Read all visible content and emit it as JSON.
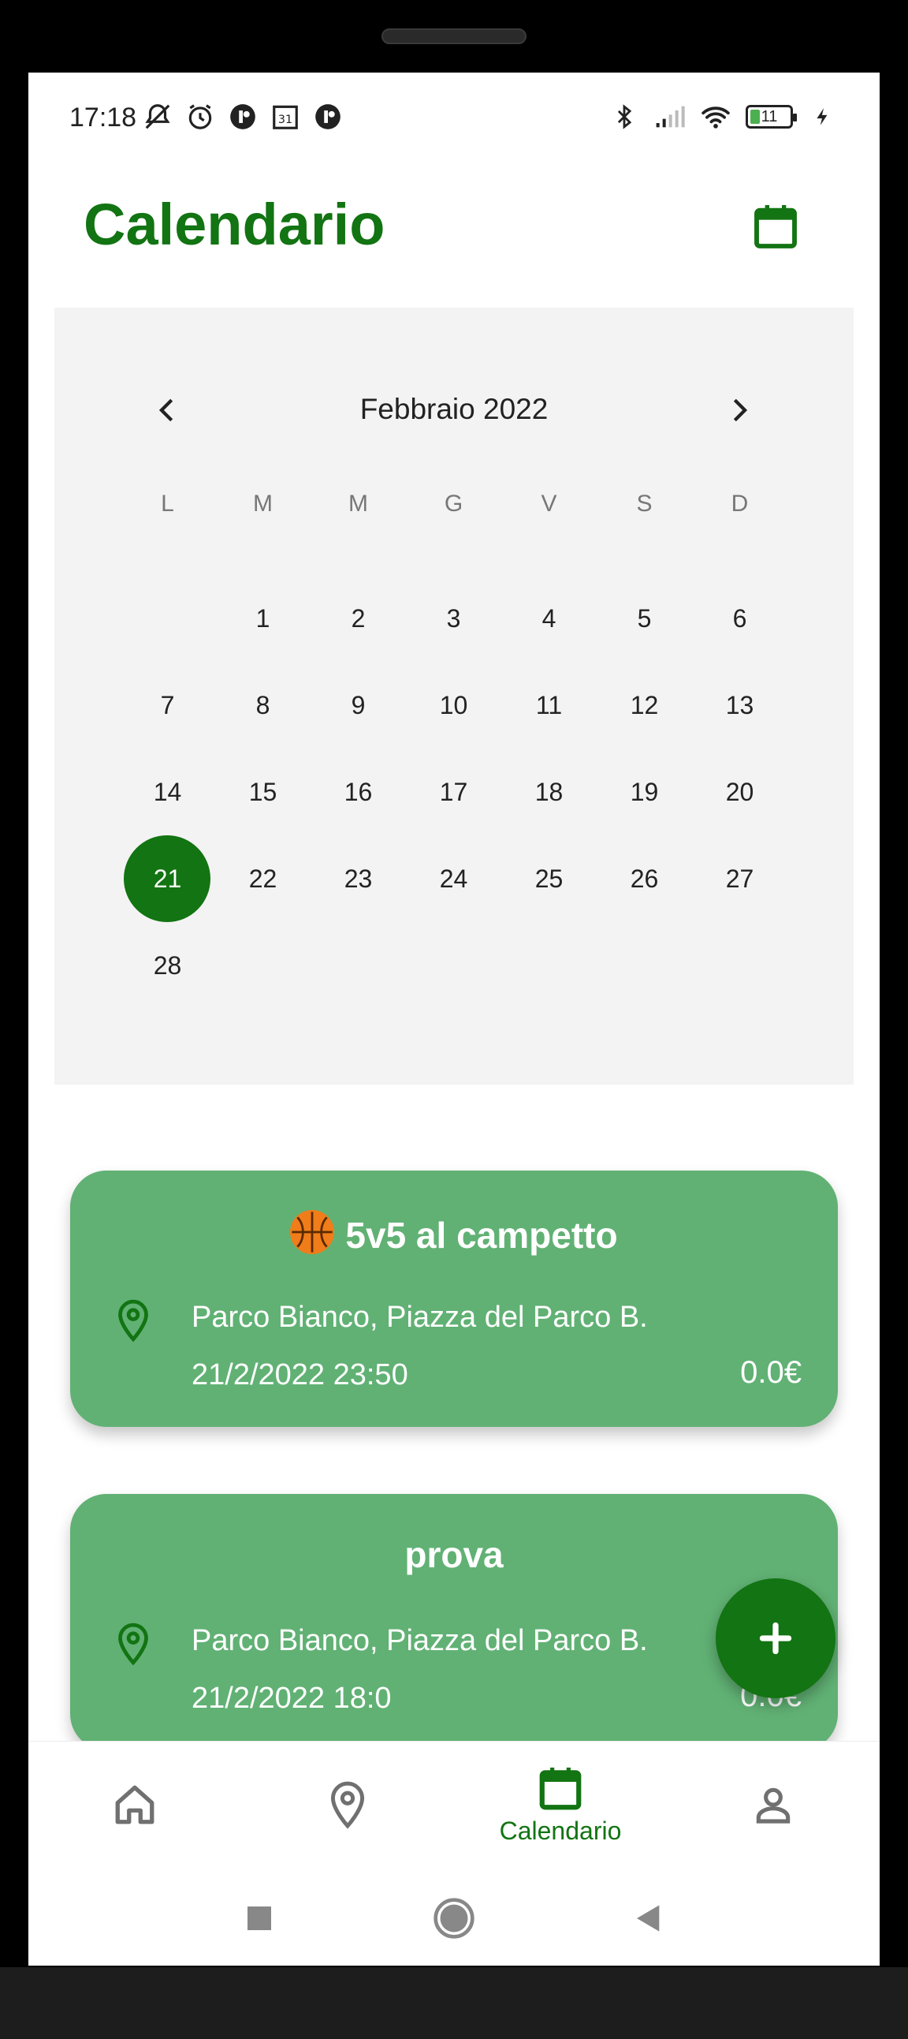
{
  "status_bar": {
    "time": "17:18",
    "left_icons": [
      "mute-icon",
      "alarm-icon",
      "app-icon",
      "calendar-31-icon",
      "app-icon"
    ],
    "right_icons": [
      "bluetooth-icon",
      "signal-icon",
      "wifi-icon",
      "battery-icon",
      "charging-icon"
    ],
    "battery_level": "11"
  },
  "header": {
    "title": "Calendario",
    "calendar_icon": "calendar-icon"
  },
  "calendar": {
    "month_label": "Febbraio 2022",
    "weekdays": [
      "L",
      "M",
      "M",
      "G",
      "V",
      "S",
      "D"
    ],
    "weeks": [
      [
        "",
        "1",
        "2",
        "3",
        "4",
        "5",
        "6"
      ],
      [
        "7",
        "8",
        "9",
        "10",
        "11",
        "12",
        "13"
      ],
      [
        "14",
        "15",
        "16",
        "17",
        "18",
        "19",
        "20"
      ],
      [
        "21",
        "22",
        "23",
        "24",
        "25",
        "26",
        "27"
      ],
      [
        "28",
        "",
        "",
        "",
        "",
        "",
        ""
      ]
    ],
    "selected_day": "21"
  },
  "events": [
    {
      "title": "5v5 al campetto",
      "has_ball_emoji": true,
      "location": "Parco Bianco, Piazza del Parco B.",
      "datetime": "21/2/2022 23:50",
      "price": "0.0€"
    },
    {
      "title": "prova",
      "has_ball_emoji": false,
      "location": "Parco Bianco, Piazza del Parco B.",
      "datetime": "21/2/2022 18:0",
      "price": "0.0€"
    }
  ],
  "fab": {
    "icon": "plus-icon"
  },
  "bottom_nav": {
    "items": [
      {
        "icon": "home-icon",
        "label": ""
      },
      {
        "icon": "location-pin-icon",
        "label": ""
      },
      {
        "icon": "calendar-icon",
        "label": "Calendario",
        "active": true
      },
      {
        "icon": "person-icon",
        "label": ""
      }
    ]
  },
  "colors": {
    "accent": "#127412",
    "card": "#61b174",
    "calendar_bg": "#f3f3f3"
  }
}
